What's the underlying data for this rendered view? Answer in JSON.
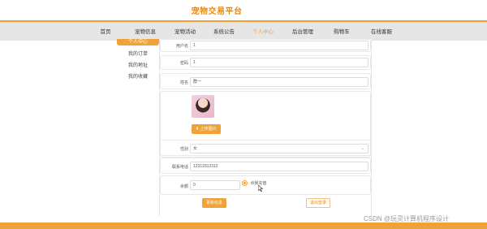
{
  "site": {
    "title": "宠物交易平台"
  },
  "nav": {
    "items": [
      {
        "label": "首页"
      },
      {
        "label": "宠物信息"
      },
      {
        "label": "宠物活动"
      },
      {
        "label": "系统公告"
      },
      {
        "label": "个人中心"
      },
      {
        "label": "后台管理"
      },
      {
        "label": "购物车"
      },
      {
        "label": "在线客服"
      }
    ],
    "active": "个人中心"
  },
  "sidebar": {
    "items": [
      {
        "label": "个人中心"
      },
      {
        "label": "我的订单"
      },
      {
        "label": "我的地址"
      },
      {
        "label": "我的收藏"
      }
    ]
  },
  "form": {
    "username": {
      "label": "用户名",
      "value": "1"
    },
    "password": {
      "label": "密码",
      "value": "1"
    },
    "name": {
      "label": "姓名",
      "value": "群一"
    },
    "upload_label": "上传图片",
    "gender": {
      "label": "性别",
      "value": "女"
    },
    "phone": {
      "label": "联系电话",
      "value": "12312312312"
    },
    "balance": {
      "label": "余额",
      "value": "0"
    },
    "recharge_option": "点我充值",
    "update_button": "更新信息",
    "logout_button": "退出登录"
  },
  "watermark": "CSDN @玩灵计算机程序设计",
  "colors": {
    "accent": "#f0a13a",
    "title": "#e98b12"
  }
}
